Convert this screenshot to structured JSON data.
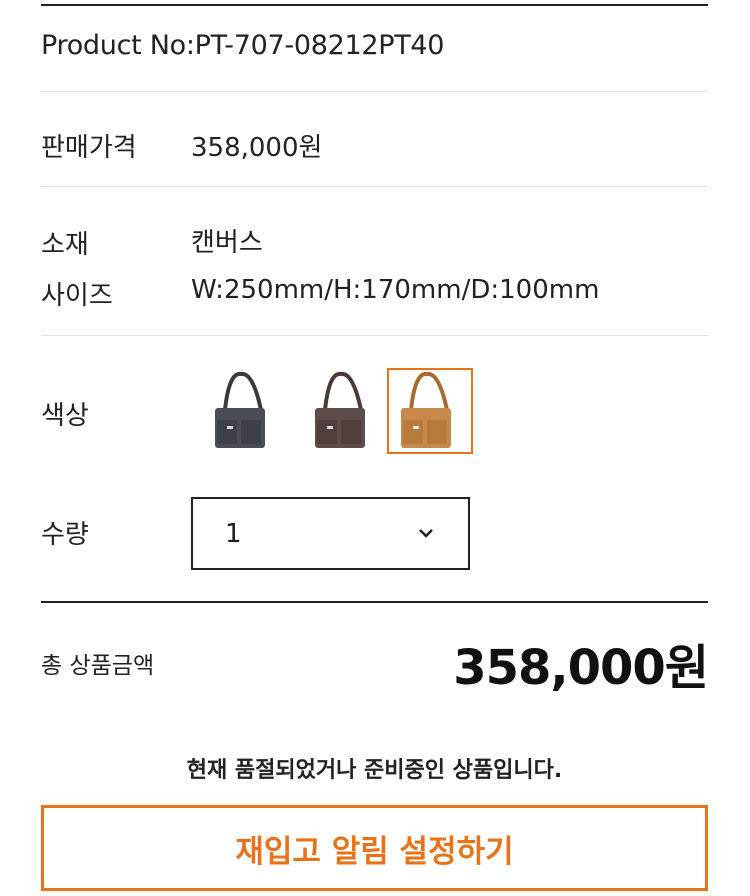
{
  "product": {
    "product_no": "Product No:PT-707-08212PT40"
  },
  "price_row": {
    "label": "판매가격",
    "value": "358,000원"
  },
  "material_row": {
    "label": "소재",
    "value": "캔버스"
  },
  "size_row": {
    "label": "사이즈",
    "value": "W:250mm/H:170mm/D:100mm"
  },
  "color_row": {
    "label": "색상",
    "swatches": [
      {
        "name": "charcoal",
        "color": "#4a4d55",
        "strap": "#3a3a3e",
        "selected": false
      },
      {
        "name": "brown",
        "color": "#5d4c4a",
        "strap": "#4a3b38",
        "selected": false
      },
      {
        "name": "camel",
        "color": "#c88a4a",
        "strap": "#a86a30",
        "selected": true
      }
    ]
  },
  "quantity_row": {
    "label": "수량",
    "selected": "1"
  },
  "total": {
    "label": "총 상품금액",
    "value": "358,000원"
  },
  "notice": "현재 품절되었거나 준비중인 상품입니다.",
  "restock_button": {
    "label": "재입고 알림 설정하기"
  },
  "colors": {
    "accent": "#e8731a",
    "text": "#222222",
    "divider": "#e2e2e2"
  }
}
